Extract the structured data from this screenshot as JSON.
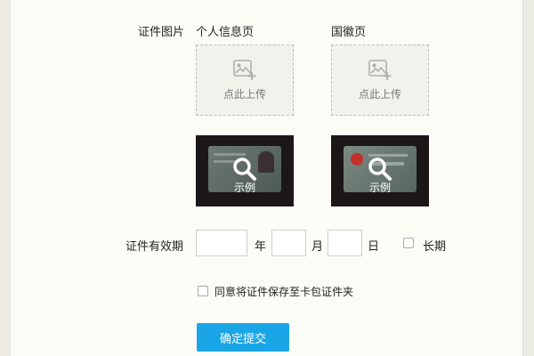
{
  "form": {
    "id_image_label": "证件图片",
    "personal_page_title": "个人信息页",
    "emblem_page_title": "国徽页",
    "upload_text": "点此上传",
    "example_text": "示例",
    "validity_label": "证件有效期",
    "year_unit": "年",
    "month_unit": "月",
    "day_unit": "日",
    "long_term_label": "长期",
    "agree_label": "同意将证件保存至卡包证件夹",
    "submit_label": "确定提交"
  },
  "colors": {
    "accent": "#1aa6e6",
    "background": "#fcfcf7"
  }
}
